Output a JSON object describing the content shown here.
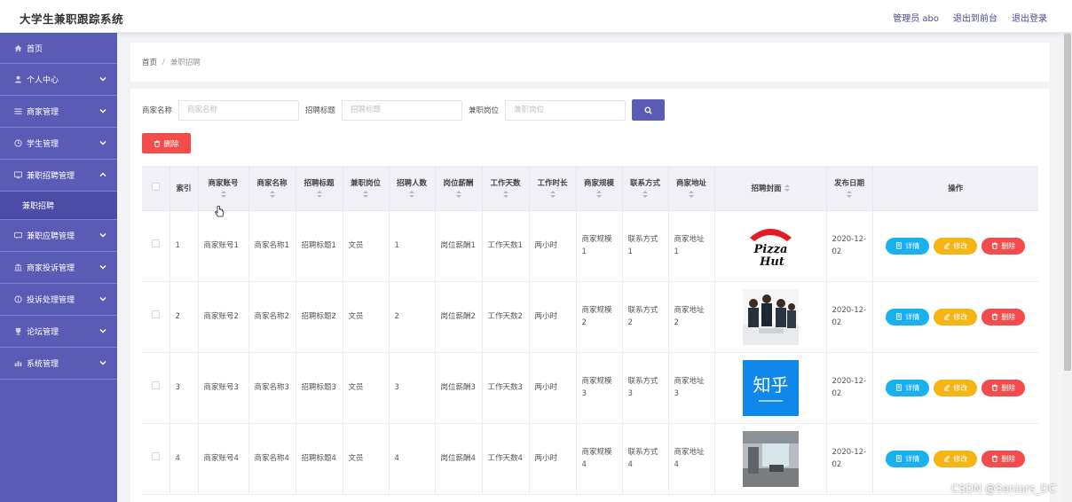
{
  "app": {
    "title": "大学生兼职跟踪系统"
  },
  "header": {
    "admin": "管理员 abo",
    "front": "退出到前台",
    "logout": "退出登录"
  },
  "sidebar": {
    "items": [
      {
        "label": "首页",
        "icon": "home-icon",
        "expandable": false
      },
      {
        "label": "个人中心",
        "icon": "user-icon",
        "expandable": true
      },
      {
        "label": "商家管理",
        "icon": "list-icon",
        "expandable": true
      },
      {
        "label": "学生管理",
        "icon": "clock-icon",
        "expandable": true
      },
      {
        "label": "兼职招聘管理",
        "icon": "monitor-icon",
        "expandable": true,
        "expanded": true,
        "sub": "兼职招聘"
      },
      {
        "label": "兼职应聘管理",
        "icon": "chat-icon",
        "expandable": true
      },
      {
        "label": "商家投诉管理",
        "icon": "bank-icon",
        "expandable": true
      },
      {
        "label": "投诉处理管理",
        "icon": "info-icon",
        "expandable": true
      },
      {
        "label": "论坛管理",
        "icon": "trophy-icon",
        "expandable": true
      },
      {
        "label": "系统管理",
        "icon": "chart-icon",
        "expandable": true
      }
    ]
  },
  "breadcrumb": {
    "home": "首页",
    "sep": "/",
    "current": "兼职招聘"
  },
  "search": {
    "merchant_label": "商家名称",
    "merchant_ph": "商家名称",
    "title_label": "招聘标题",
    "title_ph": "招聘标题",
    "position_label": "兼职岗位",
    "position_ph": "兼职岗位"
  },
  "toolbar": {
    "delete": "删除"
  },
  "table": {
    "headers": [
      "索引",
      "商家账号",
      "商家名称",
      "招聘标题",
      "兼职岗位",
      "招聘人数",
      "岗位薪酬",
      "工作天数",
      "工作时长",
      "商家规模",
      "联系方式",
      "商家地址",
      "招聘封面",
      "发布日期",
      "操作"
    ],
    "ops": {
      "detail": "详情",
      "edit": "修改",
      "delete": "删除"
    },
    "rows": [
      {
        "idx": "1",
        "account": "商家账号1",
        "name": "商家名称1",
        "title": "招聘标题1",
        "position": "文员",
        "count": "1",
        "salary": "岗位薪酬1",
        "days": "工作天数1",
        "hours": "两小时",
        "scale": "商家规模1",
        "contact": "联系方式1",
        "address": "商家地址1",
        "cover": "pizza-hut",
        "date": "2020-12-02"
      },
      {
        "idx": "2",
        "account": "商家账号2",
        "name": "商家名称2",
        "title": "招聘标题2",
        "position": "文员",
        "count": "2",
        "salary": "岗位薪酬2",
        "days": "工作天数2",
        "hours": "两小时",
        "scale": "商家规模2",
        "contact": "联系方式2",
        "address": "商家地址2",
        "cover": "office-people",
        "date": "2020-12-02"
      },
      {
        "idx": "3",
        "account": "商家账号3",
        "name": "商家名称3",
        "title": "招聘标题3",
        "position": "文员",
        "count": "3",
        "salary": "岗位薪酬3",
        "days": "工作天数3",
        "hours": "两小时",
        "scale": "商家规模3",
        "contact": "联系方式3",
        "address": "商家地址3",
        "cover": "zhihu",
        "date": "2020-12-02"
      },
      {
        "idx": "4",
        "account": "商家账号4",
        "name": "商家名称4",
        "title": "招聘标题4",
        "position": "文员",
        "count": "4",
        "salary": "岗位薪酬4",
        "days": "工作天数4",
        "hours": "两小时",
        "scale": "商家规模4",
        "contact": "联系方式4",
        "address": "商家地址4",
        "cover": "office-room",
        "date": "2020-12-02"
      }
    ]
  },
  "watermark": "CSDN @Seniors_DC",
  "colors": {
    "primary": "#5a5bb5",
    "danger": "#f24c4c",
    "info": "#1ab0ef",
    "warning": "#f7b515"
  }
}
